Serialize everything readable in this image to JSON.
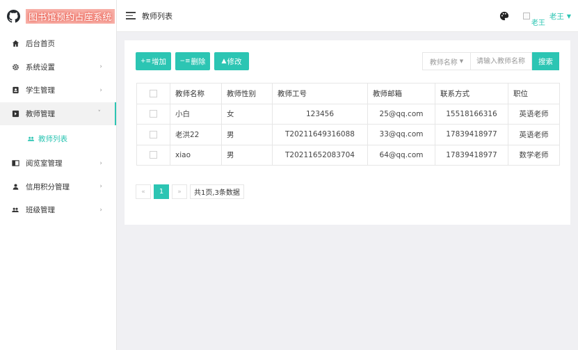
{
  "app": {
    "title": "图书馆预约占座系统"
  },
  "sidebar": {
    "items": [
      {
        "label": "后台首页",
        "icon": "home-icon"
      },
      {
        "label": "系统设置",
        "icon": "gear-icon"
      },
      {
        "label": "学生管理",
        "icon": "id-card-icon"
      },
      {
        "label": "教师管理",
        "icon": "teacher-icon"
      },
      {
        "label": "教师列表",
        "icon": "users-icon"
      },
      {
        "label": "阅览室管理",
        "icon": "book-icon"
      },
      {
        "label": "信用积分管理",
        "icon": "user-icon"
      },
      {
        "label": "班级管理",
        "icon": "group-icon"
      }
    ]
  },
  "header": {
    "breadcrumb": "教师列表",
    "avatar_alt": "老王",
    "username": "老王"
  },
  "toolbar": {
    "add_label": "增加",
    "delete_label": "删除",
    "edit_label": "修改",
    "search_field": "教师名称",
    "search_placeholder": "请输入教师名称",
    "search_button": "搜索"
  },
  "table": {
    "headers": [
      "教师名称",
      "教师性别",
      "教师工号",
      "教师邮箱",
      "联系方式",
      "职位"
    ],
    "rows": [
      [
        "小白",
        "女",
        "123456",
        "25@qq.com",
        "15518166316",
        "英语老师"
      ],
      [
        "老洪22",
        "男",
        "T20211649316088",
        "33@qq.com",
        "17839418977",
        "英语老师"
      ],
      [
        "xiao",
        "男",
        "T20211652083704",
        "64@qq.com",
        "17839418977",
        "数学老师"
      ]
    ]
  },
  "pagination": {
    "prev": "«",
    "current": "1",
    "next": "»",
    "info": "共1页,3条数据"
  },
  "colors": {
    "accent": "#2cc5b3"
  }
}
